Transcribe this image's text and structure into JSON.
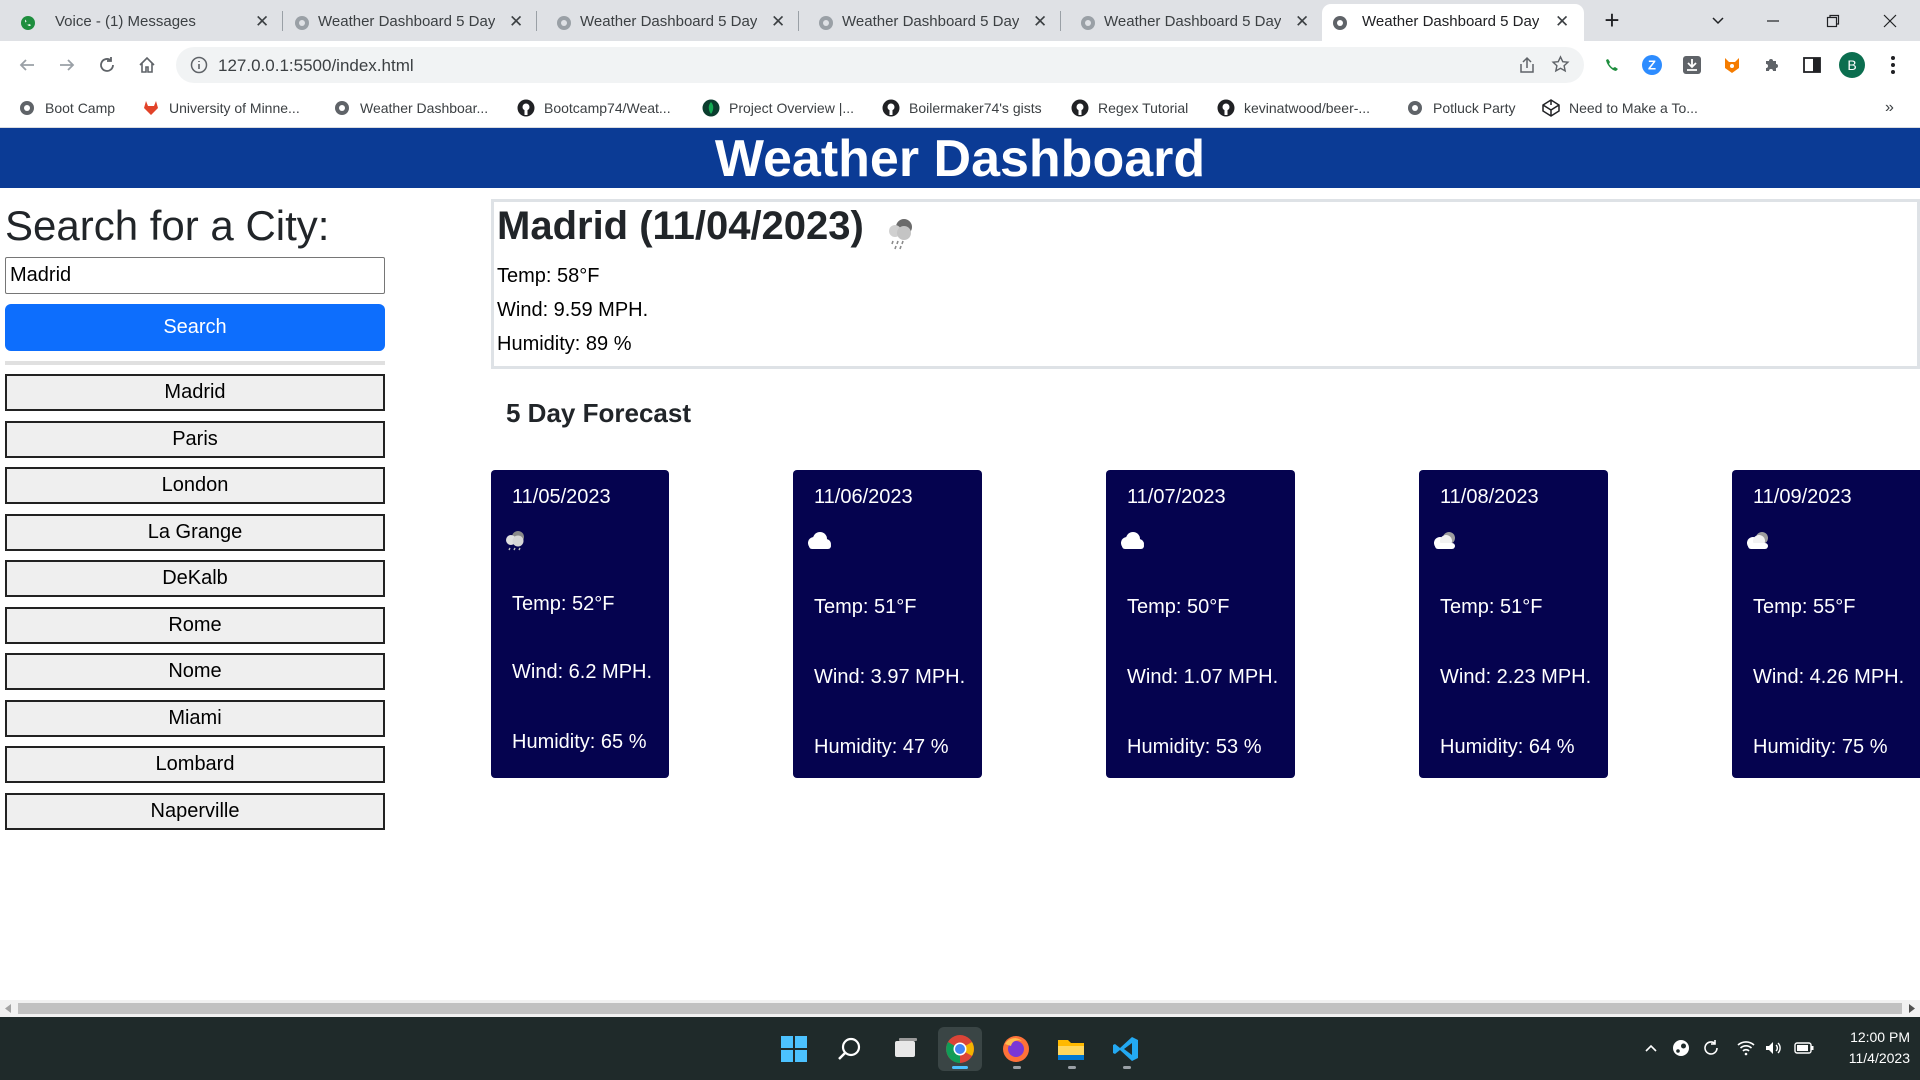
{
  "browser": {
    "tabs": [
      {
        "title": "Voice - (1) Messages",
        "active": false
      },
      {
        "title": "Weather Dashboard 5 Day",
        "active": false
      },
      {
        "title": "Weather Dashboard 5 Day",
        "active": false
      },
      {
        "title": "Weather Dashboard 5 Day",
        "active": false
      },
      {
        "title": "Weather Dashboard 5 Day",
        "active": false
      },
      {
        "title": "Weather Dashboard 5 Day",
        "active": true
      }
    ],
    "new_tab_label": "+",
    "url": "127.0.0.1:5500/index.html",
    "profile_initial": "B",
    "bookmarks": [
      {
        "label": "Boot Camp",
        "icon": "globe-icon"
      },
      {
        "label": "University of Minne...",
        "icon": "gitlab-icon"
      },
      {
        "label": "Weather Dashboar...",
        "icon": "globe-icon"
      },
      {
        "label": "Bootcamp74/Weat...",
        "icon": "github-icon"
      },
      {
        "label": "Project Overview |...",
        "icon": "leaf-icon"
      },
      {
        "label": "Boilermaker74's gists",
        "icon": "github-icon"
      },
      {
        "label": "Regex Tutorial",
        "icon": "github-icon"
      },
      {
        "label": "kevinatwood/beer-...",
        "icon": "github-icon"
      },
      {
        "label": "Potluck Party",
        "icon": "globe-icon"
      },
      {
        "label": "Need to Make a To...",
        "icon": "codepen-icon"
      }
    ],
    "bookmarks_overflow": "»"
  },
  "page": {
    "header_title": "Weather Dashboard",
    "search": {
      "heading": "Search for a City:",
      "input_value": "Madrid",
      "button_label": "Search"
    },
    "history": [
      "Madrid",
      "Paris",
      "London",
      "La Grange",
      "DeKalb",
      "Rome",
      "Nome",
      "Miami",
      "Lombard",
      "Naperville"
    ],
    "current": {
      "title": "Madrid (11/04/2023)",
      "icon": "rain-cloud-icon",
      "temp": "Temp: 58°F",
      "wind": "Wind: 9.59 MPH.",
      "humidity": "Humidity: 89 %"
    },
    "forecast_heading": "5 Day Forecast",
    "forecast": [
      {
        "date": "11/05/2023",
        "icon": "rain-cloud-icon",
        "temp": "Temp: 52°F",
        "wind": "Wind: 6.2 MPH.",
        "humidity": "Humidity: 65 %"
      },
      {
        "date": "11/06/2023",
        "icon": "cloud-icon",
        "temp": "Temp: 51°F",
        "wind": "Wind: 3.97 MPH.",
        "humidity": "Humidity: 47 %"
      },
      {
        "date": "11/07/2023",
        "icon": "cloud-icon",
        "temp": "Temp: 50°F",
        "wind": "Wind: 1.07 MPH.",
        "humidity": "Humidity: 53 %"
      },
      {
        "date": "11/08/2023",
        "icon": "broken-clouds-icon",
        "temp": "Temp: 51°F",
        "wind": "Wind: 2.23 MPH.",
        "humidity": "Humidity: 64 %"
      },
      {
        "date": "11/09/2023",
        "icon": "broken-clouds-icon",
        "temp": "Temp: 55°F",
        "wind": "Wind: 4.26 MPH.",
        "humidity": "Humidity: 75 %"
      }
    ]
  },
  "taskbar": {
    "time": "12:00 PM",
    "date": "11/4/2023"
  },
  "colors": {
    "header_bg": "#0b3b95",
    "search_button": "#0d6efd",
    "forecast_card": "#05034f"
  }
}
